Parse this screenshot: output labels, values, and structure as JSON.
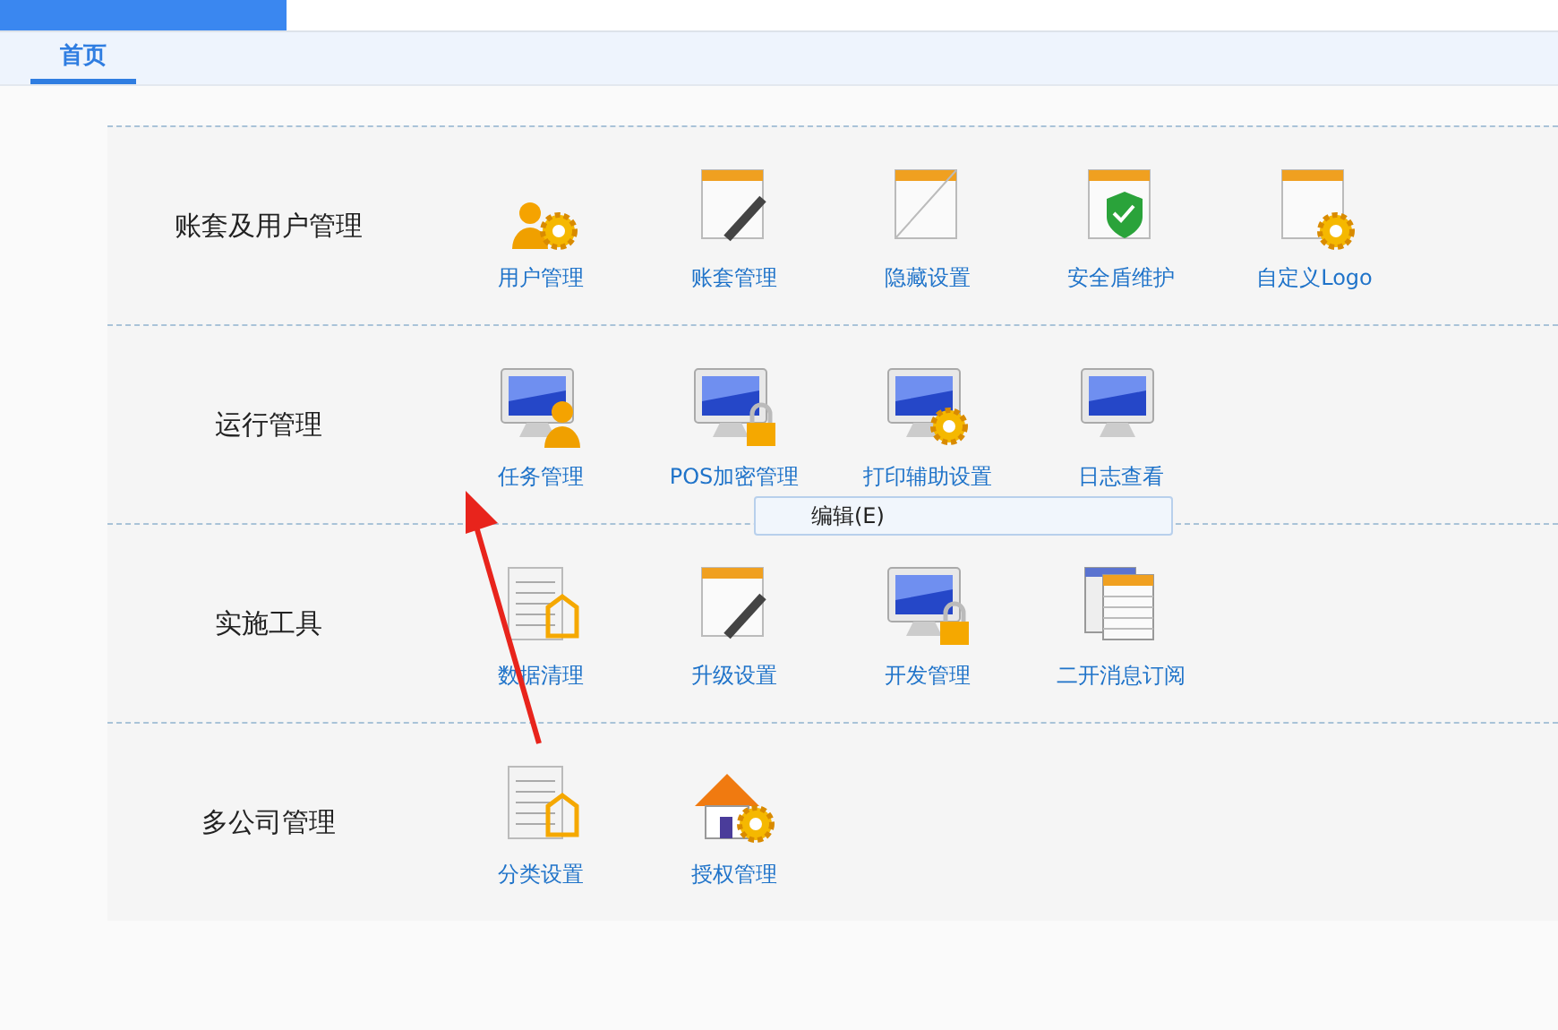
{
  "tabs": [
    {
      "label": "首页",
      "selected": true
    }
  ],
  "sections": [
    {
      "title": "账套及用户管理",
      "items": [
        {
          "label": "用户管理"
        },
        {
          "label": "账套管理"
        },
        {
          "label": "隐藏设置"
        },
        {
          "label": "安全盾维护"
        },
        {
          "label": "自定义Logo"
        }
      ]
    },
    {
      "title": "运行管理",
      "items": [
        {
          "label": "任务管理"
        },
        {
          "label": "POS加密管理"
        },
        {
          "label": "打印辅助设置"
        },
        {
          "label": "日志查看"
        }
      ]
    },
    {
      "title": "实施工具",
      "items": [
        {
          "label": "数据清理"
        },
        {
          "label": "升级设置"
        },
        {
          "label": "开发管理"
        },
        {
          "label": "二开消息订阅"
        }
      ]
    },
    {
      "title": "多公司管理",
      "items": [
        {
          "label": "分类设置"
        },
        {
          "label": "授权管理"
        }
      ]
    }
  ],
  "context_menu": {
    "items": [
      "编辑(E)"
    ]
  }
}
